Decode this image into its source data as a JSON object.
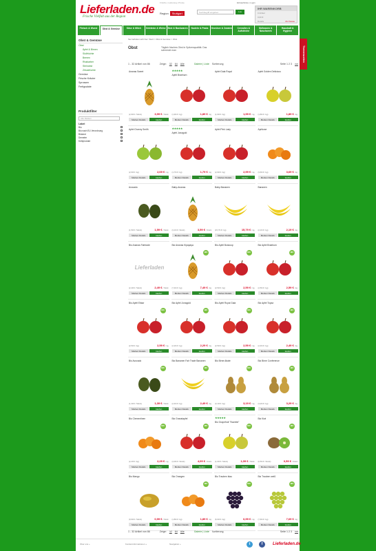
{
  "header": {
    "logo": "Lieferladen.de",
    "tagline": "Frische Vielfalt aus der Region",
    "toplinks": "Frische | Lieferung | Preise",
    "login": "Einkaufsliste | Login",
    "region_label": "Region",
    "region_value": "Stuttgart",
    "search_placeholder": "Suchbegriff eingeben",
    "search_button": "Los"
  },
  "cart": {
    "title": "IHR WARENKORB",
    "line1": "0 Artikel",
    "line2": "0,00 €",
    "details": "Details",
    "checkout": "Zur Kasse"
  },
  "nav": [
    "Fleisch & Wurst",
    "Obst & Gemüse",
    "Käse & Milch",
    "Getränke & Weine",
    "Brot & Backwaren",
    "Nudeln & Pasta",
    "Gewürze & Zutaten",
    "Cerealien & Aufstriche",
    "Süßwaren & Naschwerk",
    "Haushalt & Hygiene"
  ],
  "sidebar": {
    "title": "Obst & Gemüse",
    "items": [
      "Obst",
      "Äpfel & Birnen",
      "Südfrüchte",
      "Beeren",
      "Rhabarber",
      "Steinobst",
      "Zitrusfrüchte",
      "Gemüse",
      "Frische Kräuter",
      "Sprossen",
      "Fertigsalate"
    ]
  },
  "filter": {
    "title": "Produktfilter",
    "dropdown": "Alle Marken",
    "label_heading": "Label",
    "labels": [
      "Bio",
      "Bio nach EU Verordnung",
      "Bioland",
      "Demeter",
      "Kühlprodukt"
    ]
  },
  "main": {
    "breadcrumb": "Sie befinden sich hier: Start > Obst & Gemüse > Obst",
    "title": "Obst",
    "description": "Täglich frisches Obst in Spitzenqualität. Das schmeckt man",
    "pager_info": "1 - 32 Artikel von 86",
    "show_label": "Zeige:",
    "show_opts": [
      "32",
      "64",
      "Alle"
    ],
    "view": "Galerie | Liste",
    "sort": "Sortierung",
    "pages": "Seite 1 2 3",
    "next": "vor"
  },
  "buttons": {
    "details": "Merken Details",
    "buy": "kaufen"
  },
  "side_tab": "Themenwelten",
  "products": [
    {
      "name": "Ananas Sweet",
      "unit": "(2,99 € / Stück)",
      "price": "3,99 €",
      "per": "/ Stück",
      "img": "pineapple"
    },
    {
      "name": "Apfel Braeburn",
      "unit": "(1,99 € / kg)",
      "price": "1,89 €",
      "per": "/ kg",
      "img": "red_apple",
      "stars": "★★★★★"
    },
    {
      "name": "Apfel Gala Royal",
      "unit": "(1,99 € / kg)",
      "price": "1,99 €",
      "per": "/ kg",
      "img": "red_apple"
    },
    {
      "name": "Apfel Golden Delicious",
      "unit": "(1,89 € / kg)",
      "price": "1,89 €",
      "per": "/ kg",
      "img": "yellow_apple"
    },
    {
      "name": "Apfel Granny Smith",
      "unit": "(2,69 € / kg)",
      "price": "2,69 €",
      "per": "/ kg",
      "img": "green_apple"
    },
    {
      "name": "Apfel Jonagold",
      "unit": "(1,79 € / kg)",
      "price": "1,79 €",
      "per": "/ kg",
      "img": "red_apple",
      "stars": "★★★★★"
    },
    {
      "name": "Apfel Pink Lady",
      "unit": "(2,99 € / kg)",
      "price": "2,99 €",
      "per": "/ kg",
      "img": "red_apple"
    },
    {
      "name": "Aprikose",
      "unit": "(3,69 € / kg)",
      "price": "3,69 €",
      "per": "/ kg",
      "img": "orange_small"
    },
    {
      "name": "Avocado",
      "unit": "(1,59 € / Stück)",
      "price": "1,59 €",
      "per": "/ Stück",
      "img": "avocado"
    },
    {
      "name": "Baby-Ananas",
      "unit": "(3,19 € / Stück)",
      "price": "3,59 €",
      "per": "/ Stück",
      "img": "pineapple"
    },
    {
      "name": "Baby-Bananen",
      "unit": "(15,79 € / kg)",
      "price": "15,79 €",
      "per": "/ kg",
      "img": "banana"
    },
    {
      "name": "Bananen",
      "unit": "(2,19 € / kg)",
      "price": "2,19 €",
      "per": "/ kg",
      "img": "banana"
    },
    {
      "name": "Bio Ananas Fairtrade",
      "unit": "(2,49 € / Stück)",
      "price": "2,49 €",
      "per": "/ Stück",
      "img": "placeholder"
    },
    {
      "name": "Bio Ananas Kipapaya",
      "unit": "(7,49 € / kg)",
      "price": "7,49 €",
      "per": "/ kg",
      "img": "pineapple",
      "bio": true
    },
    {
      "name": "Bio Apfel Boskoop",
      "unit": "(2,59 € / kg)",
      "price": "2,59 €",
      "per": "/ kg",
      "img": "red_apple",
      "bio": true
    },
    {
      "name": "Bio Apfel Braeburn",
      "unit": "(2,59 € / kg)",
      "price": "2,59 €",
      "per": "/ kg",
      "img": "red_apple",
      "bio": true
    },
    {
      "name": "Bio Apfel Elstar",
      "unit": "(2,59 € / kg)",
      "price": "2,59 €",
      "per": "/ kg",
      "img": "red_apple",
      "bio": true
    },
    {
      "name": "Bio Apfel Jonagold",
      "unit": "(2,29 € / kg)",
      "price": "2,29 €",
      "per": "/ kg",
      "img": "red_apple",
      "bio": true
    },
    {
      "name": "Bio Apfel Royal Gala",
      "unit": "(2,59 € / kg)",
      "price": "2,59 €",
      "per": "/ kg",
      "img": "red_apple",
      "bio": true
    },
    {
      "name": "Bio Apfel Topaz",
      "unit": "(2,49 € / kg)",
      "price": "2,49 €",
      "per": "/ kg",
      "img": "red_apple",
      "bio": true
    },
    {
      "name": "Bio Avocado",
      "unit": "(1,39 € / Stück)",
      "price": "1,39 €",
      "per": "/ Stück",
      "img": "avocado",
      "bio": true
    },
    {
      "name": "Bio Bananen Fair Trade Bananen",
      "unit": "(2,49 € / kg)",
      "price": "2,49 €",
      "per": "/ kg",
      "img": "banana",
      "bio": true
    },
    {
      "name": "Bio Birne Abate",
      "unit": "(3,19 € / kg)",
      "price": "3,19 €",
      "per": "/ kg",
      "img": "pear",
      "bio": true
    },
    {
      "name": "Bio Birne Conference",
      "unit": "(3,29 € / kg)",
      "price": "3,29 €",
      "per": "/ kg",
      "img": "pear",
      "bio": true
    },
    {
      "name": "Bio Clementinen",
      "unit": "(2,29 € / kg)",
      "price": "2,29 €",
      "per": "/ kg",
      "img": "orange_small",
      "bio": true
    },
    {
      "name": "Bio Granatapfel",
      "unit": "(4,09 € / Stück)",
      "price": "4,09 €",
      "per": "/ Stück",
      "img": "red_apple",
      "bio": true
    },
    {
      "name": "Bio Grapefruit \"Sweetie\"",
      "unit": "(1,09 € / Stück)",
      "price": "1,09 €",
      "per": "/ Stück",
      "img": "yellow_apple",
      "bio": true,
      "stars": "★★★★★"
    },
    {
      "name": "Bio Kiwi",
      "unit": "(0,59 € / Stück)",
      "price": "0,59 €",
      "per": "/ Stück",
      "img": "kiwi",
      "bio": true
    },
    {
      "name": "Bio Mango",
      "unit": "(0,99 € / Stück)",
      "price": "0,99 €",
      "per": "/ Stück",
      "img": "mango"
    },
    {
      "name": "Bio Orangen",
      "unit": "(1,89 € / kg)",
      "price": "1,89 €",
      "per": "/ kg",
      "img": "orange_small",
      "bio": true
    },
    {
      "name": "Bio Trauben blau",
      "unit": "(6,99 € / kg)",
      "price": "6,99 €",
      "per": "/ kg",
      "img": "grapes",
      "bio": true
    },
    {
      "name": "Bio Trauben weiß",
      "unit": "(7,69 € / kg)",
      "price": "7,69 €",
      "per": "/ kg",
      "img": "grapes_green",
      "bio": true
    }
  ],
  "footer": {
    "left": "Über uns +",
    "mid": "Kundeninformationen +",
    "right": "Navigation +"
  }
}
